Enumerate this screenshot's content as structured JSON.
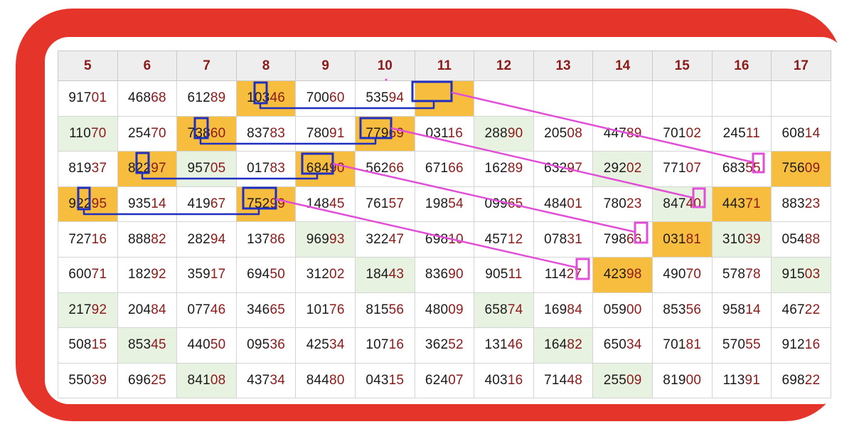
{
  "columns": [
    "5",
    "6",
    "7",
    "8",
    "9",
    "10",
    "11",
    "12",
    "13",
    "14",
    "15",
    "16",
    "17"
  ],
  "rows": [
    [
      {
        "v": "91701",
        "c": "w"
      },
      {
        "v": "46868",
        "c": "w"
      },
      {
        "v": "61289",
        "c": "w"
      },
      {
        "v": "10346",
        "c": "o"
      },
      {
        "v": "70060",
        "c": "w"
      },
      {
        "v": "53594",
        "c": "w"
      },
      {
        "v": "",
        "c": "o"
      },
      {
        "v": "",
        "c": "e"
      },
      {
        "v": "",
        "c": "e"
      },
      {
        "v": "",
        "c": "e"
      },
      {
        "v": "",
        "c": "e"
      },
      {
        "v": "",
        "c": "e"
      },
      {
        "v": "",
        "c": "e"
      }
    ],
    [
      {
        "v": "11070",
        "c": "g"
      },
      {
        "v": "25470",
        "c": "w"
      },
      {
        "v": "73860",
        "c": "o"
      },
      {
        "v": "83783",
        "c": "w"
      },
      {
        "v": "78091",
        "c": "w"
      },
      {
        "v": "77969",
        "c": "o"
      },
      {
        "v": "03116",
        "c": "w"
      },
      {
        "v": "28890",
        "c": "g"
      },
      {
        "v": "20508",
        "c": "w"
      },
      {
        "v": "44789",
        "c": "w"
      },
      {
        "v": "70102",
        "c": "w"
      },
      {
        "v": "24511",
        "c": "w"
      },
      {
        "v": "60814",
        "c": "w"
      }
    ],
    [
      {
        "v": "81937",
        "c": "w"
      },
      {
        "v": "82297",
        "c": "o"
      },
      {
        "v": "95705",
        "c": "g"
      },
      {
        "v": "01783",
        "c": "w"
      },
      {
        "v": "68490",
        "c": "o"
      },
      {
        "v": "56266",
        "c": "w"
      },
      {
        "v": "67166",
        "c": "w"
      },
      {
        "v": "16289",
        "c": "w"
      },
      {
        "v": "63297",
        "c": "w"
      },
      {
        "v": "29202",
        "c": "g"
      },
      {
        "v": "77107",
        "c": "w"
      },
      {
        "v": "68355",
        "c": "w"
      },
      {
        "v": "75609",
        "c": "o"
      }
    ],
    [
      {
        "v": "92295",
        "c": "o"
      },
      {
        "v": "93514",
        "c": "w"
      },
      {
        "v": "41967",
        "c": "w"
      },
      {
        "v": "75299",
        "c": "o"
      },
      {
        "v": "14845",
        "c": "w"
      },
      {
        "v": "76157",
        "c": "w"
      },
      {
        "v": "19854",
        "c": "w"
      },
      {
        "v": "09965",
        "c": "w"
      },
      {
        "v": "48401",
        "c": "w"
      },
      {
        "v": "78023",
        "c": "w"
      },
      {
        "v": "84740",
        "c": "g"
      },
      {
        "v": "44371",
        "c": "o"
      },
      {
        "v": "88323",
        "c": "w"
      }
    ],
    [
      {
        "v": "72716",
        "c": "w"
      },
      {
        "v": "88882",
        "c": "w"
      },
      {
        "v": "28294",
        "c": "w"
      },
      {
        "v": "13786",
        "c": "w"
      },
      {
        "v": "96993",
        "c": "g"
      },
      {
        "v": "32247",
        "c": "w"
      },
      {
        "v": "69810",
        "c": "w"
      },
      {
        "v": "45712",
        "c": "w"
      },
      {
        "v": "07831",
        "c": "w"
      },
      {
        "v": "79866",
        "c": "w"
      },
      {
        "v": "03181",
        "c": "o"
      },
      {
        "v": "31039",
        "c": "g"
      },
      {
        "v": "05488",
        "c": "w"
      }
    ],
    [
      {
        "v": "60071",
        "c": "w"
      },
      {
        "v": "18292",
        "c": "w"
      },
      {
        "v": "35917",
        "c": "w"
      },
      {
        "v": "69450",
        "c": "w"
      },
      {
        "v": "31202",
        "c": "w"
      },
      {
        "v": "18443",
        "c": "g"
      },
      {
        "v": "83690",
        "c": "w"
      },
      {
        "v": "90511",
        "c": "w"
      },
      {
        "v": "11427",
        "c": "w"
      },
      {
        "v": "42398",
        "c": "o"
      },
      {
        "v": "49070",
        "c": "w"
      },
      {
        "v": "57878",
        "c": "w"
      },
      {
        "v": "91503",
        "c": "g"
      }
    ],
    [
      {
        "v": "21792",
        "c": "g"
      },
      {
        "v": "20484",
        "c": "w"
      },
      {
        "v": "07746",
        "c": "w"
      },
      {
        "v": "34665",
        "c": "w"
      },
      {
        "v": "10176",
        "c": "w"
      },
      {
        "v": "81556",
        "c": "w"
      },
      {
        "v": "48009",
        "c": "w"
      },
      {
        "v": "65874",
        "c": "g"
      },
      {
        "v": "16984",
        "c": "w"
      },
      {
        "v": "05900",
        "c": "w"
      },
      {
        "v": "85356",
        "c": "w"
      },
      {
        "v": "95814",
        "c": "w"
      },
      {
        "v": "46722",
        "c": "w"
      }
    ],
    [
      {
        "v": "50815",
        "c": "w"
      },
      {
        "v": "85345",
        "c": "g"
      },
      {
        "v": "44050",
        "c": "w"
      },
      {
        "v": "09536",
        "c": "w"
      },
      {
        "v": "42534",
        "c": "w"
      },
      {
        "v": "10716",
        "c": "w"
      },
      {
        "v": "36252",
        "c": "w"
      },
      {
        "v": "13146",
        "c": "w"
      },
      {
        "v": "16482",
        "c": "g"
      },
      {
        "v": "65034",
        "c": "w"
      },
      {
        "v": "70181",
        "c": "w"
      },
      {
        "v": "57055",
        "c": "w"
      },
      {
        "v": "91216",
        "c": "w"
      }
    ],
    [
      {
        "v": "55039",
        "c": "w"
      },
      {
        "v": "69625",
        "c": "w"
      },
      {
        "v": "84108",
        "c": "g"
      },
      {
        "v": "43734",
        "c": "w"
      },
      {
        "v": "84480",
        "c": "w"
      },
      {
        "v": "04315",
        "c": "w"
      },
      {
        "v": "62407",
        "c": "w"
      },
      {
        "v": "40316",
        "c": "w"
      },
      {
        "v": "71448",
        "c": "w"
      },
      {
        "v": "25509",
        "c": "g"
      },
      {
        "v": "81900",
        "c": "w"
      },
      {
        "v": "11391",
        "c": "w"
      },
      {
        "v": "69822",
        "c": "w"
      }
    ]
  ],
  "colors": {
    "frame": "#e5352a",
    "header_text": "#8b1a1a",
    "highlight_fill": "#f7bd3e",
    "green_fill": "#e8f2e1",
    "blue_marker": "#1f2fbf",
    "pink_marker": "#e04fd6"
  }
}
